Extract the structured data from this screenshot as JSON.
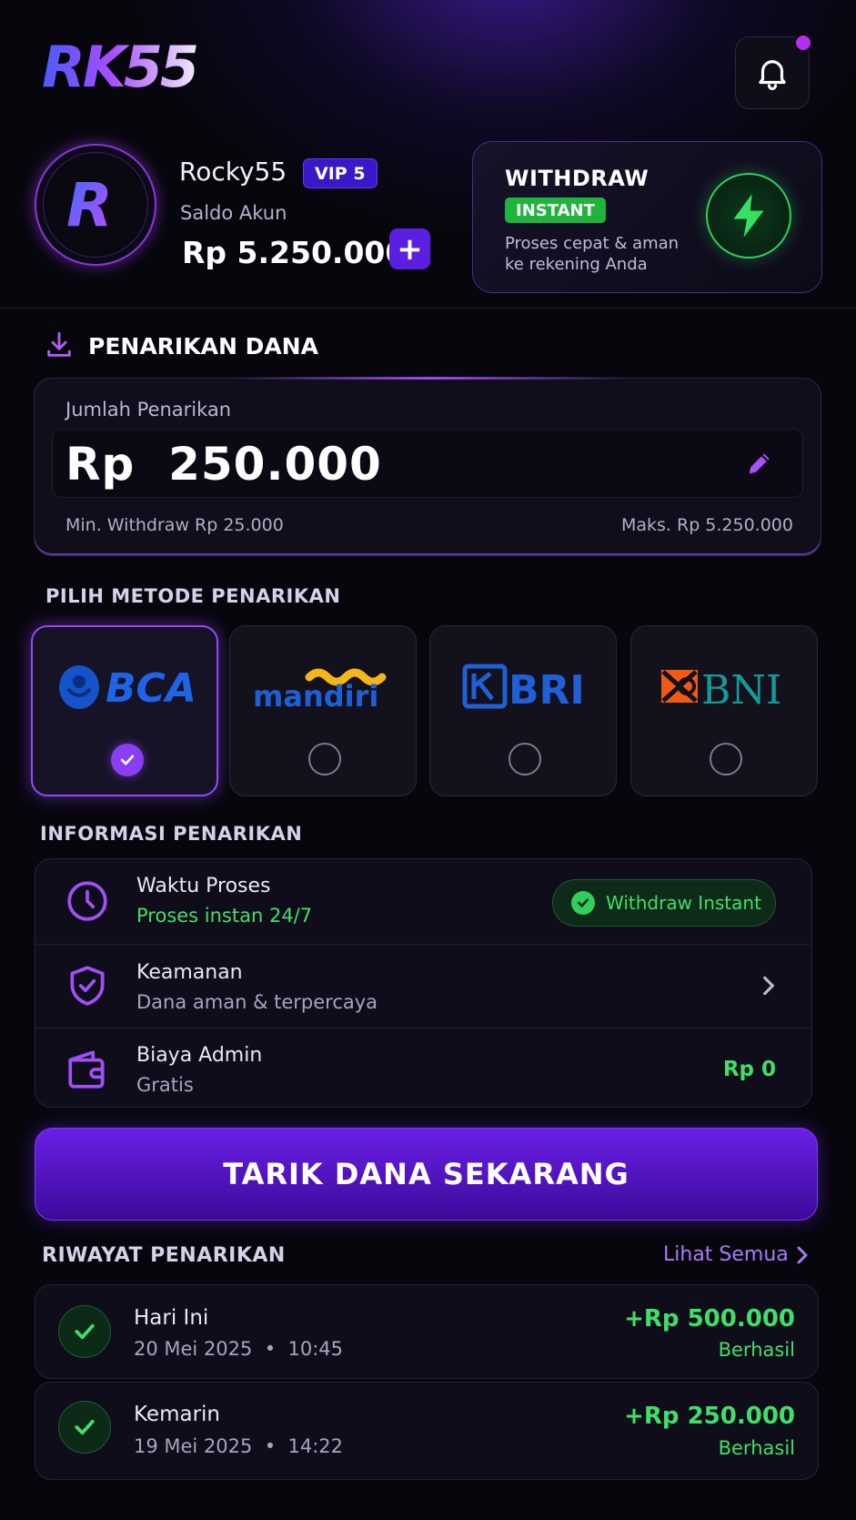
{
  "header": {
    "logo_text": "RK55"
  },
  "profile": {
    "username": "Rocky55",
    "vip_badge": "VIP 5",
    "balance_label": "Saldo Akun",
    "balance": "Rp 5.250.000",
    "add_label": "+"
  },
  "withdraw_card": {
    "title": "WITHDRAW",
    "badge": "INSTANT",
    "description": "Proses cepat & aman ke rekening Anda"
  },
  "section": {
    "title": "PENARIKAN DANA"
  },
  "amount": {
    "label": "Jumlah Penarikan",
    "value": "Rp  250.000",
    "min": "Min. Withdraw Rp 25.000",
    "max": "Maks. Rp 5.250.000"
  },
  "methods": {
    "title": "PILIH METODE PENARIKAN",
    "banks": [
      {
        "name": "BCA",
        "selected": true
      },
      {
        "name": "mandiri",
        "selected": false
      },
      {
        "name": "BRI",
        "selected": false
      },
      {
        "name": "BNI",
        "selected": false
      }
    ]
  },
  "info": {
    "title": "INFORMASI PENARIKAN",
    "rows": [
      {
        "title": "Waktu Proses",
        "subtitle": "Proses instan 24/7",
        "pill": "Withdraw Instant"
      },
      {
        "title": "Keamanan",
        "subtitle": "Dana aman & terpercaya"
      },
      {
        "title": "Biaya Admin",
        "subtitle": "Gratis",
        "value": "Rp 0"
      }
    ]
  },
  "cta": {
    "label": "TARIK DANA SEKARANG"
  },
  "history": {
    "title": "RIWAYAT PENARIKAN",
    "see_all": "Lihat Semua",
    "items": [
      {
        "title": "Hari Ini",
        "date": "20 Mei 2025  •  10:45",
        "amount": "+Rp 500.000",
        "status": "Berhasil"
      },
      {
        "title": "Kemarin",
        "date": "19 Mei 2025  •  14:22",
        "amount": "+Rp 250.000",
        "status": "Berhasil"
      }
    ]
  },
  "colors": {
    "accent": "#6a1fe6",
    "success": "#3ee06a",
    "background": "#07060d"
  }
}
